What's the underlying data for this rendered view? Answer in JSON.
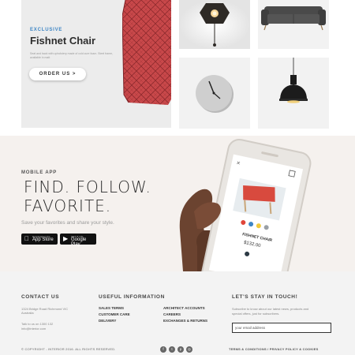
{
  "featured": {
    "tag": "EXCLUSIVE",
    "title": "Fishnet Chair",
    "description": "Seat and back with upholstery made of cold cure foam. Steel frame, available in matt",
    "button_label": "ORDER US  >"
  },
  "products": [
    {
      "name": "wall-lamp"
    },
    {
      "name": "sofa"
    },
    {
      "name": "wall-clock"
    },
    {
      "name": "pendant-lamp"
    }
  ],
  "app": {
    "label": "MOBILE APP",
    "headline_line1": "FIND. FOLLOW.",
    "headline_line2": "FAVORITE.",
    "subtext": "Save your favorites and share your style.",
    "app_store_small": "Download on the",
    "app_store_big": "App Store",
    "google_play_small": "GET IT ON",
    "google_play_big": "Google Play",
    "phone_product_title": "FISHNET CHAIR",
    "phone_product_price": "$132.00",
    "phone_close": "×",
    "phone_swatch_colors": [
      "#e0453a",
      "#3e86c5",
      "#f0c93c",
      "#9aa0a6"
    ]
  },
  "footer": {
    "contact": {
      "heading": "CONTACT US",
      "address_line1": "1324 Bridge Road Richmond VIC",
      "address_line2": "Australia",
      "phone_line": "Talk to us on 1300 132",
      "email_line": "info@interior.com"
    },
    "info": {
      "heading": "USEFUL INFORMATION",
      "col1": [
        "SALES TERMS",
        "CUSTOMER CARE",
        "DELIVERY"
      ],
      "col2": [
        "ARCHITECT ACCOUNTS",
        "CAREERS",
        "EXCHANGES & RETURNS"
      ]
    },
    "newsletter": {
      "heading": "LET'S STAY IN TOUCH!",
      "text_line1": "Subscribe to know about our latest news, products and",
      "text_line2": "special offers, just for subscribers.",
      "placeholder": "your email address"
    },
    "copyright": "© COPYRIGHT - INTERIOR 2016. ALL RIGHTS RESERVED.",
    "terms": "TERMS & CONDITIONS / PRIVACY POLICY & COOKIES",
    "social": [
      {
        "name": "facebook-icon",
        "glyph": "f"
      },
      {
        "name": "twitter-icon",
        "glyph": "t"
      },
      {
        "name": "pinterest-icon",
        "glyph": "p"
      },
      {
        "name": "instagram-icon",
        "glyph": "◎"
      }
    ]
  }
}
